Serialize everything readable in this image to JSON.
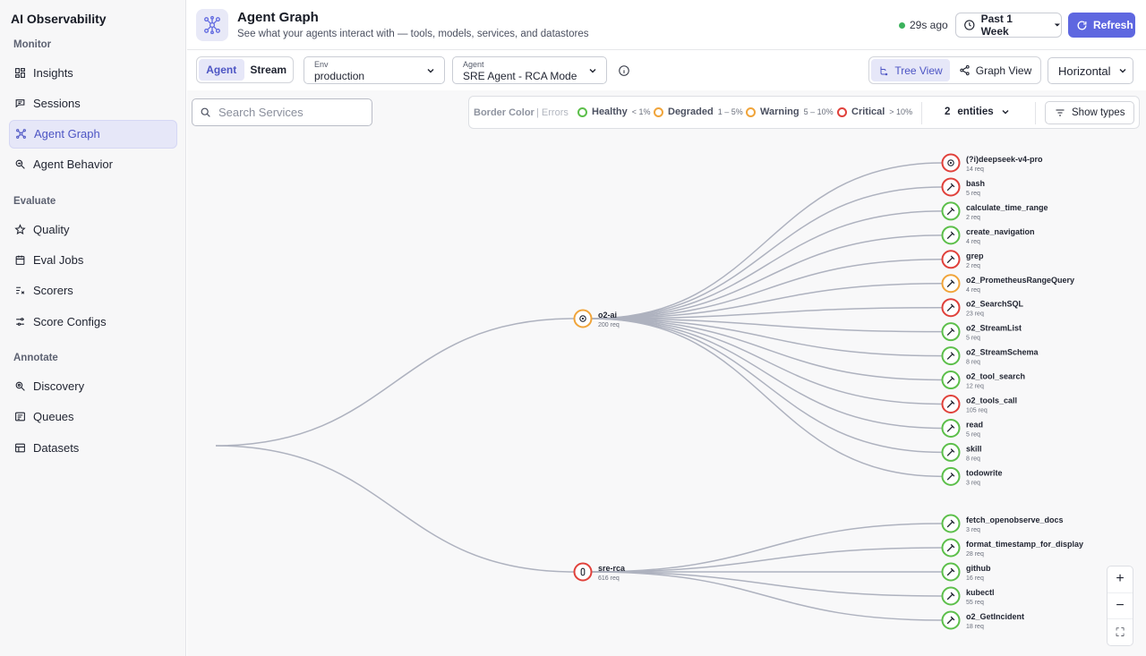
{
  "app_title": "AI Observability",
  "sidebar": {
    "sections": [
      {
        "label": "Monitor",
        "items": [
          {
            "label": "Insights",
            "icon": "dashboard-icon"
          },
          {
            "label": "Sessions",
            "icon": "chat-icon"
          },
          {
            "label": "Agent Graph",
            "icon": "graph-icon",
            "active": true
          },
          {
            "label": "Agent Behavior",
            "icon": "search-analytics-icon"
          }
        ]
      },
      {
        "label": "Evaluate",
        "items": [
          {
            "label": "Quality",
            "icon": "star-icon"
          },
          {
            "label": "Eval Jobs",
            "icon": "calendar-icon"
          },
          {
            "label": "Scorers",
            "icon": "checklist-icon"
          },
          {
            "label": "Score Configs",
            "icon": "sliders-icon"
          }
        ]
      },
      {
        "label": "Annotate",
        "items": [
          {
            "label": "Discovery",
            "icon": "discovery-icon"
          },
          {
            "label": "Queues",
            "icon": "queue-icon"
          },
          {
            "label": "Datasets",
            "icon": "table-icon"
          }
        ]
      }
    ]
  },
  "header": {
    "title": "Agent Graph",
    "subtitle": "See what your agents interact with — tools, models, services, and datastores",
    "status": "29s ago",
    "time_range": "Past 1 Week",
    "refresh_label": "Refresh"
  },
  "toolbar": {
    "mode_tabs": [
      {
        "label": "Agent",
        "active": true
      },
      {
        "label": "Stream",
        "active": false
      }
    ],
    "env": {
      "label": "Env",
      "value": "production"
    },
    "agent": {
      "label": "Agent",
      "value": "SRE Agent - RCA Mode"
    },
    "views": [
      {
        "label": "Tree View",
        "active": true
      },
      {
        "label": "Graph View",
        "active": false
      }
    ],
    "orientation": "Horizontal"
  },
  "canvas": {
    "search_placeholder": "Search Services",
    "legend": {
      "title": "Border Color",
      "subtitle": "| Errors",
      "items": [
        {
          "name": "Healthy",
          "range": "< 1%",
          "color": "#5cbf4a"
        },
        {
          "name": "Degraded",
          "range": "1 – 5%",
          "color": "#f0a43a"
        },
        {
          "name": "Warning",
          "range": "5 – 10%",
          "color": "#f0a43a"
        },
        {
          "name": "Critical",
          "range": "> 10%",
          "color": "#e0413b"
        }
      ]
    },
    "entities_count": "2",
    "entities_label": "entities",
    "show_types_label": "Show types",
    "zoom": {
      "in": "+",
      "out": "−",
      "fit": "⛶"
    }
  },
  "graph": {
    "agents": [
      {
        "name": "o2-ai",
        "count": "200 req",
        "color": "#f0a43a",
        "type": "model",
        "children": [
          {
            "name": "(?i)deepseek-v4-pro",
            "count": "14 req",
            "color": "#e0413b",
            "type": "model"
          },
          {
            "name": "bash",
            "count": "5 req",
            "color": "#e0413b",
            "type": "tool"
          },
          {
            "name": "calculate_time_range",
            "count": "2 req",
            "color": "#5cbf4a",
            "type": "tool"
          },
          {
            "name": "create_navigation",
            "count": "4 req",
            "color": "#5cbf4a",
            "type": "tool"
          },
          {
            "name": "grep",
            "count": "2 req",
            "color": "#e0413b",
            "type": "tool"
          },
          {
            "name": "o2_PrometheusRangeQuery",
            "count": "4 req",
            "color": "#f0a43a",
            "type": "tool"
          },
          {
            "name": "o2_SearchSQL",
            "count": "23 req",
            "color": "#e0413b",
            "type": "tool"
          },
          {
            "name": "o2_StreamList",
            "count": "5 req",
            "color": "#5cbf4a",
            "type": "tool"
          },
          {
            "name": "o2_StreamSchema",
            "count": "8 req",
            "color": "#5cbf4a",
            "type": "tool"
          },
          {
            "name": "o2_tool_search",
            "count": "12 req",
            "color": "#5cbf4a",
            "type": "tool"
          },
          {
            "name": "o2_tools_call",
            "count": "105 req",
            "color": "#e0413b",
            "type": "tool"
          },
          {
            "name": "read",
            "count": "5 req",
            "color": "#5cbf4a",
            "type": "tool"
          },
          {
            "name": "skill",
            "count": "8 req",
            "color": "#5cbf4a",
            "type": "tool"
          },
          {
            "name": "todowrite",
            "count": "3 req",
            "color": "#5cbf4a",
            "type": "tool"
          }
        ]
      },
      {
        "name": "sre-rca",
        "count": "616 req",
        "color": "#e0413b",
        "type": "agent",
        "children": [
          {
            "name": "fetch_openobserve_docs",
            "count": "3 req",
            "color": "#5cbf4a",
            "type": "tool"
          },
          {
            "name": "format_timestamp_for_display",
            "count": "28 req",
            "color": "#5cbf4a",
            "type": "tool"
          },
          {
            "name": "github",
            "count": "16 req",
            "color": "#5cbf4a",
            "type": "tool"
          },
          {
            "name": "kubectl",
            "count": "55 req",
            "color": "#5cbf4a",
            "type": "tool"
          },
          {
            "name": "o2_GetIncident",
            "count": "18 req",
            "color": "#5cbf4a",
            "type": "tool"
          }
        ]
      }
    ]
  }
}
